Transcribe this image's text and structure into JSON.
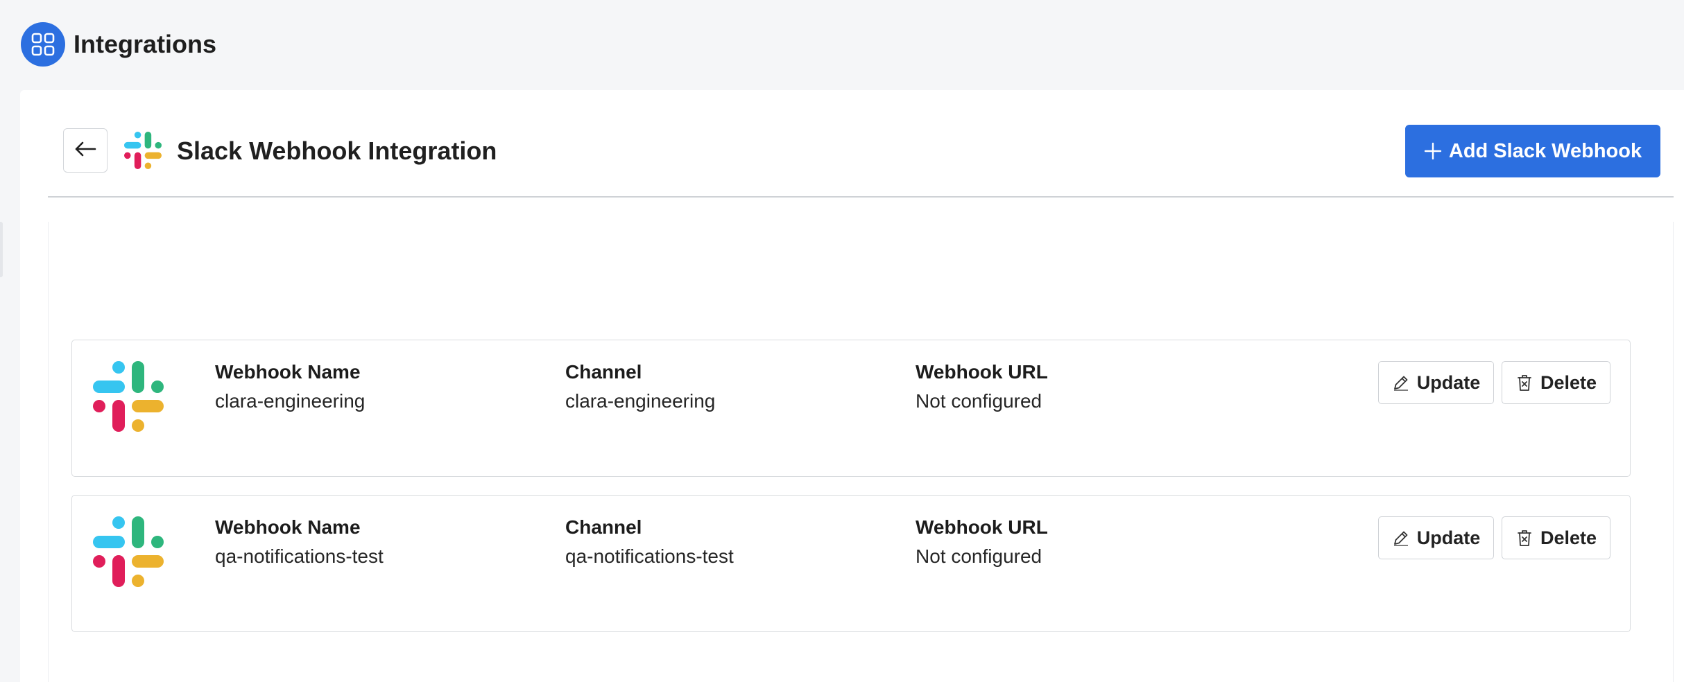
{
  "app": {
    "title": "Integrations",
    "icon": "grid-icon",
    "accent_color": "#2c6fe0"
  },
  "page": {
    "title": "Slack Webhook Integration",
    "back_icon": "arrow-left-icon",
    "logo_icon": "slack-logo-icon",
    "add_button_label": "Add Slack Webhook",
    "add_button_icon": "plus-icon"
  },
  "labels": {
    "webhook_name": "Webhook Name",
    "channel": "Channel",
    "webhook_url": "Webhook URL",
    "update": "Update",
    "delete": "Delete"
  },
  "webhooks": [
    {
      "name": "clara-engineering",
      "channel": "clara-engineering",
      "url": "Not configured"
    },
    {
      "name": "qa-notifications-test",
      "channel": "qa-notifications-test",
      "url": "Not configured"
    }
  ],
  "icons": {
    "update": "pencil-icon",
    "delete": "trash-icon"
  },
  "slack_colors": {
    "blue": "#36c5f0",
    "green": "#2eb67d",
    "red": "#e01e5a",
    "yellow": "#ecb22e"
  }
}
